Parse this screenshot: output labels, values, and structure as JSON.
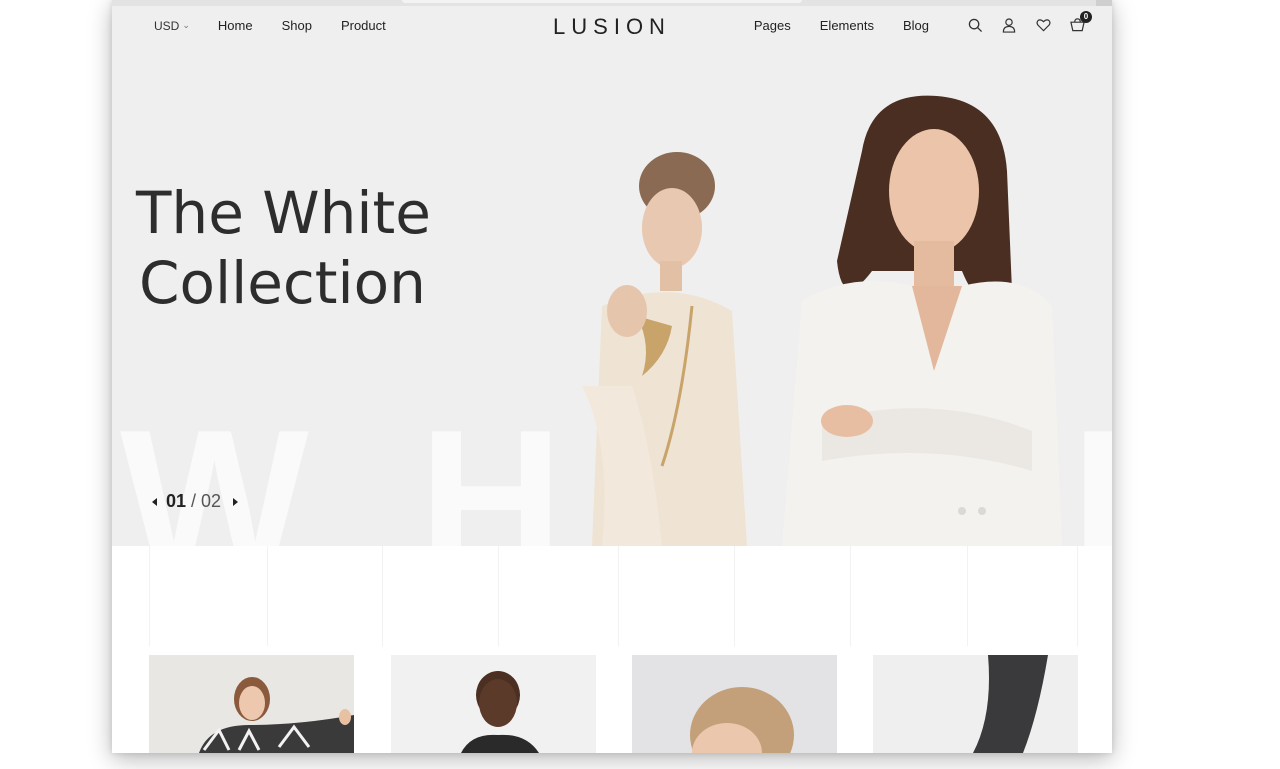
{
  "header": {
    "currency": "USD",
    "nav_left": [
      "Home",
      "Shop",
      "Product"
    ],
    "logo": "LUSION",
    "nav_right": [
      "Pages",
      "Elements",
      "Blog"
    ],
    "cart_count": "0"
  },
  "hero": {
    "title_line1": "The White",
    "title_line2": "Collection",
    "background_word": "WHITE",
    "current_slide": "01",
    "separator": "/",
    "total_slides": "02"
  },
  "colors": {
    "hero_bg": "#efefef",
    "text_dark": "#2d2d2d"
  },
  "icons": [
    "search-icon",
    "user-icon",
    "heart-icon",
    "cart-icon"
  ]
}
